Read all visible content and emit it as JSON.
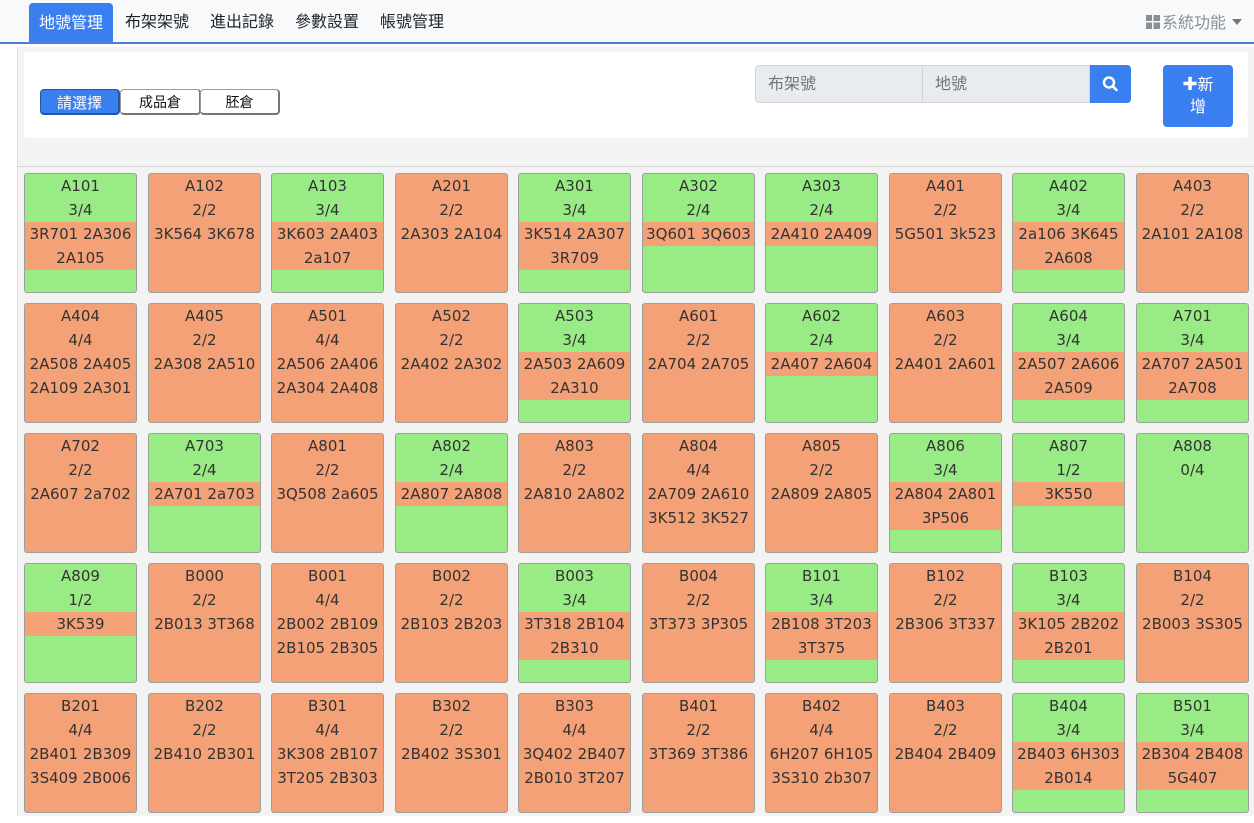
{
  "nav": {
    "tabs": [
      {
        "label": "地號管理",
        "active": true
      },
      {
        "label": "布架架號"
      },
      {
        "label": "進出記錄"
      },
      {
        "label": "參數設置"
      },
      {
        "label": "帳號管理"
      }
    ],
    "system_label": "系統功能"
  },
  "filters": {
    "options": [
      "請選擇",
      "成品倉",
      "胚倉"
    ],
    "selected": "請選擇"
  },
  "search": {
    "rack_placeholder": "布架號",
    "lot_placeholder": "地號",
    "button_icon": "search-icon"
  },
  "add_button": {
    "line1": "新",
    "line2": "增",
    "icon": "plus-icon"
  },
  "colors": {
    "accent": "#3a7ff0",
    "available": "#99eb85",
    "full": "#f4a177"
  },
  "slots": [
    {
      "name": "A101",
      "count": "3/4",
      "items": [
        "3R701 2A306",
        "2A105"
      ],
      "status": "green"
    },
    {
      "name": "A102",
      "count": "2/2",
      "items": [
        "3K564 3K678"
      ],
      "status": "orange"
    },
    {
      "name": "A103",
      "count": "3/4",
      "items": [
        "3K603 2A403",
        "2a107"
      ],
      "status": "green"
    },
    {
      "name": "A201",
      "count": "2/2",
      "items": [
        "2A303 2A104"
      ],
      "status": "orange"
    },
    {
      "name": "A301",
      "count": "3/4",
      "items": [
        "3K514 2A307",
        "3R709"
      ],
      "status": "green"
    },
    {
      "name": "A302",
      "count": "2/4",
      "items": [
        "3Q601 3Q603"
      ],
      "status": "green"
    },
    {
      "name": "A303",
      "count": "2/4",
      "items": [
        "2A410 2A409"
      ],
      "status": "green"
    },
    {
      "name": "A401",
      "count": "2/2",
      "items": [
        "5G501 3k523"
      ],
      "status": "orange"
    },
    {
      "name": "A402",
      "count": "3/4",
      "items": [
        "2a106 3K645",
        "2A608"
      ],
      "status": "green"
    },
    {
      "name": "A403",
      "count": "2/2",
      "items": [
        "2A101 2A108"
      ],
      "status": "orange"
    },
    {
      "name": "A404",
      "count": "4/4",
      "items": [
        "2A508 2A405",
        "2A109 2A301"
      ],
      "status": "orange"
    },
    {
      "name": "A405",
      "count": "2/2",
      "items": [
        "2A308 2A510"
      ],
      "status": "orange"
    },
    {
      "name": "A501",
      "count": "4/4",
      "items": [
        "2A506 2A406",
        "2A304 2A408"
      ],
      "status": "orange"
    },
    {
      "name": "A502",
      "count": "2/2",
      "items": [
        "2A402 2A302"
      ],
      "status": "orange"
    },
    {
      "name": "A503",
      "count": "3/4",
      "items": [
        "2A503 2A609",
        "2A310"
      ],
      "status": "green"
    },
    {
      "name": "A601",
      "count": "2/2",
      "items": [
        "2A704 2A705"
      ],
      "status": "orange"
    },
    {
      "name": "A602",
      "count": "2/4",
      "items": [
        "2A407 2A604"
      ],
      "status": "green"
    },
    {
      "name": "A603",
      "count": "2/2",
      "items": [
        "2A401 2A601"
      ],
      "status": "orange"
    },
    {
      "name": "A604",
      "count": "3/4",
      "items": [
        "2A507 2A606",
        "2A509"
      ],
      "status": "green"
    },
    {
      "name": "A701",
      "count": "3/4",
      "items": [
        "2A707 2A501",
        "2A708"
      ],
      "status": "green"
    },
    {
      "name": "A702",
      "count": "2/2",
      "items": [
        "2A607 2a702"
      ],
      "status": "orange"
    },
    {
      "name": "A703",
      "count": "2/4",
      "items": [
        "2A701 2a703"
      ],
      "status": "green"
    },
    {
      "name": "A801",
      "count": "2/2",
      "items": [
        "3Q508 2a605"
      ],
      "status": "orange"
    },
    {
      "name": "A802",
      "count": "2/4",
      "items": [
        "2A807 2A808"
      ],
      "status": "green"
    },
    {
      "name": "A803",
      "count": "2/2",
      "items": [
        "2A810 2A802"
      ],
      "status": "orange"
    },
    {
      "name": "A804",
      "count": "4/4",
      "items": [
        "2A709 2A610",
        "3K512 3K527"
      ],
      "status": "orange"
    },
    {
      "name": "A805",
      "count": "2/2",
      "items": [
        "2A809 2A805"
      ],
      "status": "orange"
    },
    {
      "name": "A806",
      "count": "3/4",
      "items": [
        "2A804 2A801",
        "3P506"
      ],
      "status": "green"
    },
    {
      "name": "A807",
      "count": "1/2",
      "items": [
        "3K550"
      ],
      "status": "green"
    },
    {
      "name": "A808",
      "count": "0/4",
      "items": [],
      "status": "green"
    },
    {
      "name": "A809",
      "count": "1/2",
      "items": [
        "3K539"
      ],
      "status": "green"
    },
    {
      "name": "B000",
      "count": "2/2",
      "items": [
        "2B013 3T368"
      ],
      "status": "orange"
    },
    {
      "name": "B001",
      "count": "4/4",
      "items": [
        "2B002 2B109",
        "2B105 2B305"
      ],
      "status": "orange"
    },
    {
      "name": "B002",
      "count": "2/2",
      "items": [
        "2B103 2B203"
      ],
      "status": "orange"
    },
    {
      "name": "B003",
      "count": "3/4",
      "items": [
        "3T318 2B104",
        "2B310"
      ],
      "status": "green"
    },
    {
      "name": "B004",
      "count": "2/2",
      "items": [
        "3T373 3P305"
      ],
      "status": "orange"
    },
    {
      "name": "B101",
      "count": "3/4",
      "items": [
        "2B108 3T203",
        "3T375"
      ],
      "status": "green"
    },
    {
      "name": "B102",
      "count": "2/2",
      "items": [
        "2B306 3T337"
      ],
      "status": "orange"
    },
    {
      "name": "B103",
      "count": "3/4",
      "items": [
        "3K105 2B202",
        "2B201"
      ],
      "status": "green"
    },
    {
      "name": "B104",
      "count": "2/2",
      "items": [
        "2B003 3S305"
      ],
      "status": "orange"
    },
    {
      "name": "B201",
      "count": "4/4",
      "items": [
        "2B401 2B309",
        "3S409 2B006"
      ],
      "status": "orange"
    },
    {
      "name": "B202",
      "count": "2/2",
      "items": [
        "2B410 2B301"
      ],
      "status": "orange"
    },
    {
      "name": "B301",
      "count": "4/4",
      "items": [
        "3K308 2B107",
        "3T205 2B303"
      ],
      "status": "orange"
    },
    {
      "name": "B302",
      "count": "2/2",
      "items": [
        "2B402 3S301"
      ],
      "status": "orange"
    },
    {
      "name": "B303",
      "count": "4/4",
      "items": [
        "3Q402 2B407",
        "2B010 3T207"
      ],
      "status": "orange"
    },
    {
      "name": "B401",
      "count": "2/2",
      "items": [
        "3T369 3T386"
      ],
      "status": "orange"
    },
    {
      "name": "B402",
      "count": "4/4",
      "items": [
        "6H207 6H105",
        "3S310 2b307"
      ],
      "status": "orange"
    },
    {
      "name": "B403",
      "count": "2/2",
      "items": [
        "2B404 2B409"
      ],
      "status": "orange"
    },
    {
      "name": "B404",
      "count": "3/4",
      "items": [
        "2B403 6H303",
        "2B014"
      ],
      "status": "green"
    },
    {
      "name": "B501",
      "count": "3/4",
      "items": [
        "2B304 2B408",
        "5G407"
      ],
      "status": "green"
    }
  ]
}
